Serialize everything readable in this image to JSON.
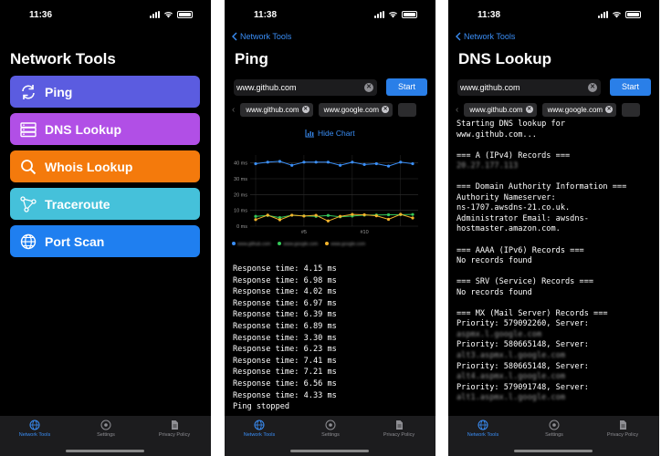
{
  "screens": {
    "menu": {
      "time": "11:36",
      "title": "Network Tools",
      "buttons": [
        {
          "label": "Ping",
          "color": "#5b5ce0"
        },
        {
          "label": "DNS Lookup",
          "color": "#b14fe6"
        },
        {
          "label": "Whois Lookup",
          "color": "#f47a0c"
        },
        {
          "label": "Traceroute",
          "color": "#45c1da"
        },
        {
          "label": "Port Scan",
          "color": "#1f7ff0"
        }
      ]
    },
    "ping": {
      "time": "11:38",
      "back_label": "Network Tools",
      "title": "Ping",
      "search_value": "www.github.com",
      "start_label": "Start",
      "chips": [
        "www.github.com",
        "www.google.com"
      ],
      "hide_chart_label": "Hide Chart",
      "chart_data": {
        "type": "line",
        "yticks": [
          "40 ms",
          "30 ms",
          "20 ms",
          "10 ms",
          "0 ms"
        ],
        "xticks": [
          "#5",
          "#10"
        ],
        "ylim": [
          0,
          45
        ],
        "series": [
          {
            "name": "www.github.com",
            "color": "#3a8ef6",
            "values": [
              39.5,
              40.5,
              41,
              38.5,
              40.5,
              40.5,
              40.5,
              38.5,
              40.5,
              39,
              39.5,
              38,
              40.5,
              39.5
            ]
          },
          {
            "name": "www.google.com",
            "color": "#34c759",
            "values": [
              6.2,
              6.8,
              5.4,
              6.9,
              6.5,
              6.2,
              6.8,
              5.9,
              6.4,
              7.0,
              7.1,
              7.2,
              7.3,
              7.4
            ]
          },
          {
            "name": "www.google.com",
            "color": "#f2b32c",
            "values": [
              4.15,
              6.98,
              4.02,
              6.97,
              6.39,
              6.89,
              3.3,
              6.23,
              7.41,
              7.21,
              6.56,
              4.33,
              7.5,
              5.2
            ]
          }
        ]
      },
      "output_lines": [
        "Response time: 4.15 ms",
        "Response time: 6.98 ms",
        "Response time: 4.02 ms",
        "Response time: 6.97 ms",
        "Response time: 6.39 ms",
        "Response time: 6.89 ms",
        "Response time: 3.30 ms",
        "Response time: 6.23 ms",
        "Response time: 7.41 ms",
        "Response time: 7.21 ms",
        "Response time: 6.56 ms",
        "Response time: 4.33 ms",
        "Ping stopped"
      ]
    },
    "dns": {
      "time": "11:38",
      "back_label": "Network Tools",
      "title": "DNS Lookup",
      "search_value": "www.github.com",
      "start_label": "Start",
      "chips": [
        "www.github.com",
        "www.google.com"
      ],
      "output_lines": [
        {
          "text": "Starting DNS lookup for",
          "blur": false
        },
        {
          "text": "www.github.com...",
          "blur": false
        },
        {
          "text": "",
          "blur": false
        },
        {
          "text": "=== A (IPv4) Records ===",
          "blur": false
        },
        {
          "text": "20.27.177.113",
          "blur": true
        },
        {
          "text": "",
          "blur": false
        },
        {
          "text": "=== Domain Authority Information ===",
          "blur": false
        },
        {
          "text": "Authority Nameserver:",
          "blur": false
        },
        {
          "text": "ns-1707.awsdns-21.co.uk.",
          "blur": false
        },
        {
          "text": "Administrator Email: awsdns-",
          "blur": false
        },
        {
          "text": "hostmaster.amazon.com.",
          "blur": false
        },
        {
          "text": "",
          "blur": false
        },
        {
          "text": "=== AAAA (IPv6) Records ===",
          "blur": false
        },
        {
          "text": "No records found",
          "blur": false
        },
        {
          "text": "",
          "blur": false
        },
        {
          "text": "=== SRV (Service) Records ===",
          "blur": false
        },
        {
          "text": "No records found",
          "blur": false
        },
        {
          "text": "",
          "blur": false
        },
        {
          "text": "=== MX (Mail Server) Records ===",
          "blur": false
        },
        {
          "text": "Priority: 579092260, Server:",
          "blur": false
        },
        {
          "text": "aspmx.l.google.com",
          "blur": true
        },
        {
          "text": "Priority: 580665148, Server:",
          "blur": false
        },
        {
          "text": "alt3.aspmx.l.google.com",
          "blur": true
        },
        {
          "text": "Priority: 580665148, Server:",
          "blur": false
        },
        {
          "text": "alt4.aspmx.l.google.com",
          "blur": true
        },
        {
          "text": "Priority: 579091748, Server:",
          "blur": false
        },
        {
          "text": "alt1.aspmx.l.google.com",
          "blur": true
        }
      ]
    }
  },
  "tabbar": {
    "tabs": [
      {
        "label": "Network Tools",
        "icon": "globe-icon"
      },
      {
        "label": "Settings",
        "icon": "gear-icon"
      },
      {
        "label": "Privacy Policy",
        "icon": "document-icon"
      }
    ],
    "active_color": "#3a8ef6",
    "inactive_color": "#8e8e93"
  }
}
